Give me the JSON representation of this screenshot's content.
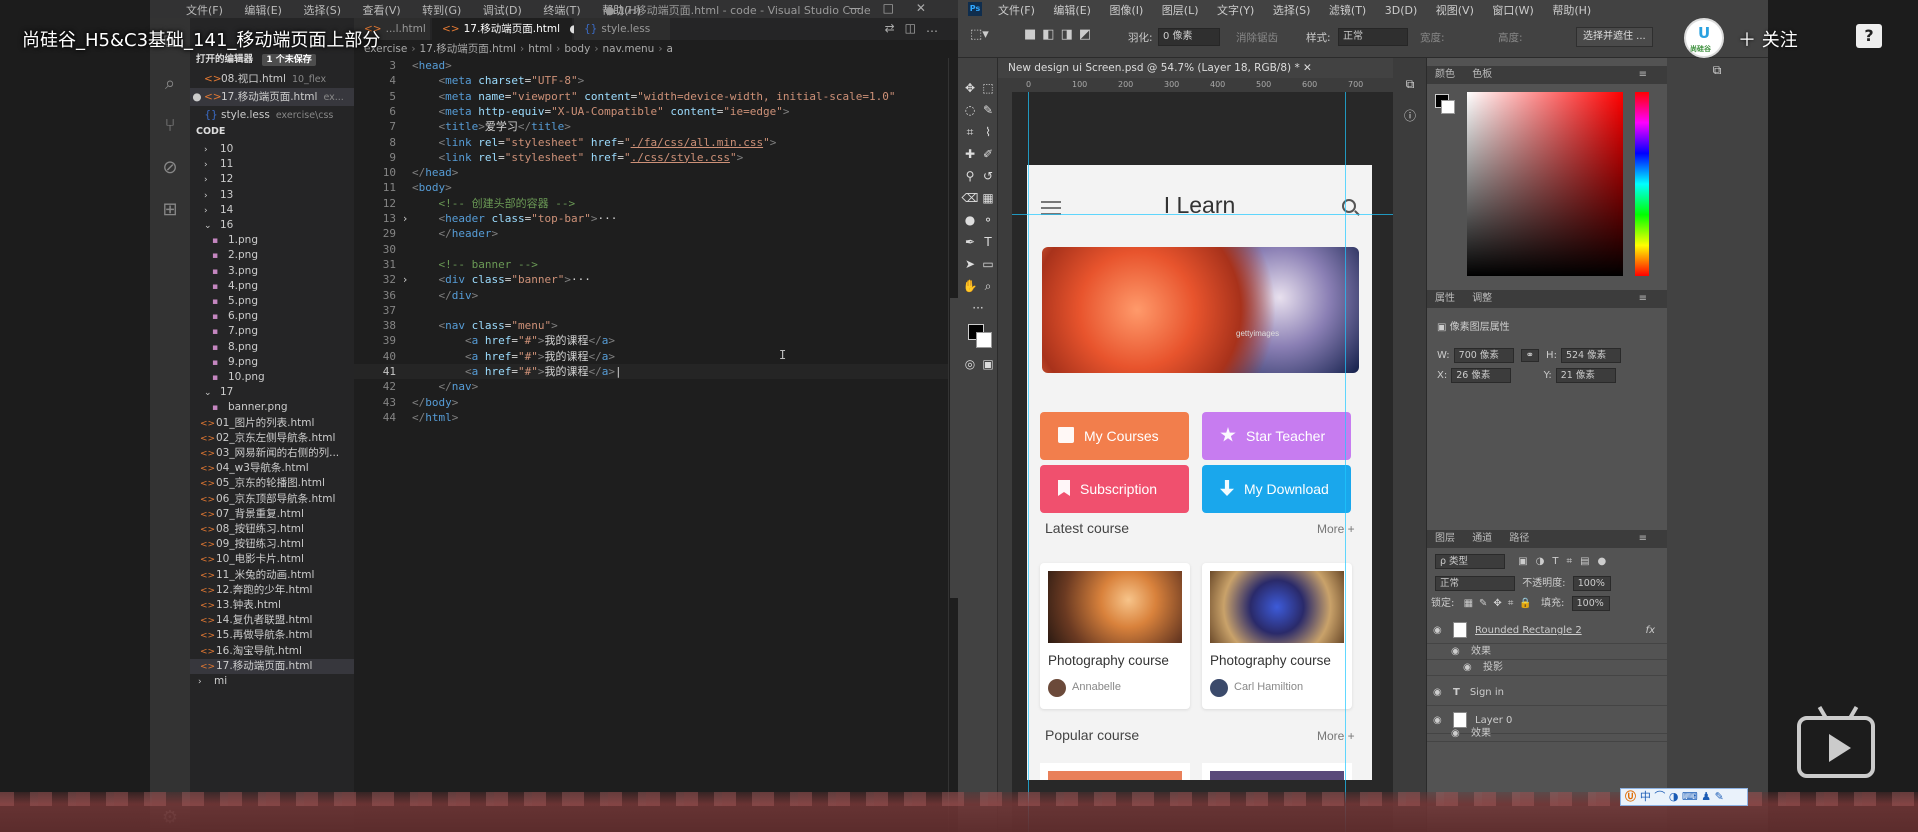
{
  "overlay": {
    "video_title": "尚硅谷_H5&C3基础_141_移动端页面上部分",
    "follow_label": "＋ 关注",
    "logo_text": "尚硅谷",
    "help_glyph": "?"
  },
  "vscode": {
    "menu": [
      "文件(F)",
      "编辑(E)",
      "选择(S)",
      "查看(V)",
      "转到(G)",
      "调试(D)",
      "终端(T)",
      "帮助(H)"
    ],
    "window_title": "● 17.移动端页面.html - code - Visual Studio Code",
    "tabs": [
      {
        "label": "...l.html",
        "icon": "<>"
      },
      {
        "label": "17.移动端页面.html",
        "icon": "<>",
        "dirty": "●"
      },
      {
        "label": "style.less",
        "icon": "{}"
      }
    ],
    "breadcrumb": [
      "exercise",
      "17.移动端页面.html",
      "html",
      "body",
      "nav.menu",
      "a"
    ],
    "sidebar": {
      "open_editors_label": "打开的编辑器",
      "unsaved_badge": "1 个未保存",
      "open_editors": [
        {
          "icon": "<>",
          "name": "08.视口.html",
          "path": "10_flex"
        },
        {
          "icon": "<>",
          "name": "17.移动端页面.html",
          "path": "ex..."
        },
        {
          "icon": "{}",
          "name": "style.less",
          "path": "exercise\\css"
        }
      ],
      "code_label": "CODE",
      "tree": [
        {
          "kind": "folder",
          "label": "10"
        },
        {
          "kind": "folder",
          "label": "11"
        },
        {
          "kind": "folder",
          "label": "12"
        },
        {
          "kind": "folder",
          "label": "13"
        },
        {
          "kind": "folder",
          "label": "14"
        },
        {
          "kind": "folder-open",
          "label": "16"
        },
        {
          "kind": "file",
          "label": "1.png"
        },
        {
          "kind": "file",
          "label": "2.png"
        },
        {
          "kind": "file",
          "label": "3.png"
        },
        {
          "kind": "file",
          "label": "4.png"
        },
        {
          "kind": "file",
          "label": "5.png"
        },
        {
          "kind": "file",
          "label": "6.png"
        },
        {
          "kind": "file",
          "label": "7.png"
        },
        {
          "kind": "file",
          "label": "8.png"
        },
        {
          "kind": "file",
          "label": "9.png"
        },
        {
          "kind": "file",
          "label": "10.png"
        },
        {
          "kind": "folder-open",
          "label": "17"
        },
        {
          "kind": "file",
          "label": "banner.png"
        },
        {
          "kind": "html",
          "label": "01_图片的列表.html"
        },
        {
          "kind": "html",
          "label": "02_京东左侧导航条.html"
        },
        {
          "kind": "html",
          "label": "03_网易新闻的右侧的列..."
        },
        {
          "kind": "html",
          "label": "04_w3导航条.html"
        },
        {
          "kind": "html",
          "label": "05_京东的轮播图.html"
        },
        {
          "kind": "html",
          "label": "06_京东顶部导航条.html"
        },
        {
          "kind": "html",
          "label": "07_背景重复.html"
        },
        {
          "kind": "html",
          "label": "08_按钮练习.html"
        },
        {
          "kind": "html",
          "label": "09_按钮练习.html"
        },
        {
          "kind": "html",
          "label": "10_电影卡片.html"
        },
        {
          "kind": "html",
          "label": "11_米兔的动画.html"
        },
        {
          "kind": "html",
          "label": "12.奔跑的少年.html"
        },
        {
          "kind": "html",
          "label": "13.钟表.html"
        },
        {
          "kind": "html",
          "label": "14.复仇者联盟.html"
        },
        {
          "kind": "html",
          "label": "15.再做导航条.html"
        },
        {
          "kind": "html",
          "label": "16.淘宝导航.html"
        },
        {
          "kind": "html",
          "label": "17.移动端页面.html"
        },
        {
          "kind": "folder",
          "label": "mi"
        }
      ]
    },
    "code": [
      {
        "n": "3",
        "html": "<span class='tg'>&lt;</span><span class='tn'>head</span><span class='tg'>&gt;</span>"
      },
      {
        "n": "4",
        "html": "    <span class='tg'>&lt;</span><span class='tn'>meta</span> <span class='at'>charset</span>=<span class='st'>\"UTF-8\"</span><span class='tg'>&gt;</span>"
      },
      {
        "n": "5",
        "html": "    <span class='tg'>&lt;</span><span class='tn'>meta</span> <span class='at'>name</span>=<span class='st'>\"viewport\"</span> <span class='at'>content</span>=<span class='st'>\"width=device-width, initial-scale=1.0\"</span>"
      },
      {
        "n": "6",
        "html": "    <span class='tg'>&lt;</span><span class='tn'>meta</span> <span class='at'>http-equiv</span>=<span class='st'>\"X-UA-Compatible\"</span> <span class='at'>content</span>=<span class='st'>\"ie=edge\"</span><span class='tg'>&gt;</span>"
      },
      {
        "n": "7",
        "html": "    <span class='tg'>&lt;</span><span class='tn'>title</span><span class='tg'>&gt;</span><span class='tx'>爱学习</span><span class='tg'>&lt;/</span><span class='tn'>title</span><span class='tg'>&gt;</span>"
      },
      {
        "n": "8",
        "html": "    <span class='tg'>&lt;</span><span class='tn'>link</span> <span class='at'>rel</span>=<span class='st'>\"stylesheet\"</span> <span class='at'>href</span>=<span class='st'>\"</span><span class='sl'>./fa/css/all.min.css</span><span class='st'>\"</span><span class='tg'>&gt;</span>"
      },
      {
        "n": "9",
        "html": "    <span class='tg'>&lt;</span><span class='tn'>link</span> <span class='at'>rel</span>=<span class='st'>\"stylesheet\"</span> <span class='at'>href</span>=<span class='st'>\"</span><span class='sl'>./css/style.css</span><span class='st'>\"</span><span class='tg'>&gt;</span>"
      },
      {
        "n": "10",
        "html": "<span class='tg'>&lt;/</span><span class='tn'>head</span><span class='tg'>&gt;</span>"
      },
      {
        "n": "11",
        "html": "<span class='tg'>&lt;</span><span class='tn'>body</span><span class='tg'>&gt;</span>"
      },
      {
        "n": "12",
        "html": "    <span class='cm'>&lt;!-- 创建头部的容器 --&gt;</span>"
      },
      {
        "n": "13",
        "fold": "›",
        "html": "    <span class='tg'>&lt;</span><span class='tn'>header</span> <span class='at'>class</span>=<span class='st'>\"top-bar\"</span><span class='tg'>&gt;</span><span class='tx'>···</span>"
      },
      {
        "n": "29",
        "html": "    <span class='tg'>&lt;/</span><span class='tn'>header</span><span class='tg'>&gt;</span>"
      },
      {
        "n": "30",
        "html": ""
      },
      {
        "n": "31",
        "html": "    <span class='cm'>&lt;!-- banner --&gt;</span>"
      },
      {
        "n": "32",
        "fold": "›",
        "html": "    <span class='tg'>&lt;</span><span class='tn'>div</span> <span class='at'>class</span>=<span class='st'>\"banner\"</span><span class='tg'>&gt;</span><span class='tx'>···</span>"
      },
      {
        "n": "36",
        "html": "    <span class='tg'>&lt;/</span><span class='tn'>div</span><span class='tg'>&gt;</span>"
      },
      {
        "n": "37",
        "html": ""
      },
      {
        "n": "38",
        "html": "    <span class='tg'>&lt;</span><span class='tn'>nav</span> <span class='at'>class</span>=<span class='st'>\"menu\"</span><span class='tg'>&gt;</span>"
      },
      {
        "n": "39",
        "html": "        <span class='tg'>&lt;</span><span class='tn'>a</span> <span class='at'>href</span>=<span class='st'>\"#\"</span><span class='tg'>&gt;</span><span class='tx'>我的课程</span><span class='tg'>&lt;/</span><span class='tn'>a</span><span class='tg'>&gt;</span>"
      },
      {
        "n": "40",
        "html": "        <span class='tg'>&lt;</span><span class='tn'>a</span> <span class='at'>href</span>=<span class='st'>\"#\"</span><span class='tg'>&gt;</span><span class='tx'>我的课程</span><span class='tg'>&lt;/</span><span class='tn'>a</span><span class='tg'>&gt;</span>"
      },
      {
        "n": "41",
        "cur": true,
        "html": "        <span class='tg'>&lt;</span><span class='tn'>a</span> <span class='at'>href</span>=<span class='st'>\"#\"</span><span class='tg'>&gt;</span><span class='tx'>我的课程</span><span class='tg'>&lt;/</span><span class='tn'>a</span><span class='tg'>&gt;</span><span class='tx'>|</span>"
      },
      {
        "n": "42",
        "html": "    <span class='tg'>&lt;/</span><span class='tn'>nav</span><span class='tg'>&gt;</span>"
      },
      {
        "n": "43",
        "html": "<span class='tg'>&lt;/</span><span class='tn'>body</span><span class='tg'>&gt;</span>"
      },
      {
        "n": "44",
        "html": "<span class='tg'>&lt;/</span><span class='tn'>html</span><span class='tg'>&gt;</span>"
      }
    ]
  },
  "photoshop": {
    "menu": [
      "文件(F)",
      "编辑(E)",
      "图像(I)",
      "图层(L)",
      "文字(Y)",
      "选择(S)",
      "滤镜(T)",
      "3D(D)",
      "视图(V)",
      "窗口(W)",
      "帮助(H)"
    ],
    "options": {
      "feather_label": "羽化:",
      "feather_value": "0 像素",
      "antialias_label": "消除锯齿",
      "style_label": "样式:",
      "style_value": "正常",
      "width_label": "宽度:",
      "height_label": "高度:",
      "select_mask_button": "选择并遮住 ..."
    },
    "doc_tab": "New design ui Screen.psd @ 54.7% (Layer 18, RGB/8) * ✕",
    "ruler_ticks": [
      "0",
      "100",
      "200",
      "300",
      "400",
      "500",
      "600",
      "700"
    ],
    "artboard": {
      "title": "I Learn",
      "banner_watermark": "gettyimages",
      "buttons": [
        {
          "label": "My Courses",
          "icon": "book",
          "color": "#f27e4c"
        },
        {
          "label": "Star Teacher",
          "icon": "star",
          "color": "#c77cf0"
        },
        {
          "label": "Subscription",
          "icon": "flag",
          "color": "#f0506e"
        },
        {
          "label": "My Download",
          "icon": "down",
          "color": "#1aa7ec"
        }
      ],
      "latest_title": "Latest course",
      "popular_title": "Popular course",
      "more_label": "More +",
      "courses": [
        {
          "name": "Photography course",
          "author": "Annabelle"
        },
        {
          "name": "Photography course",
          "author": "Carl Hamiltion"
        }
      ]
    },
    "panels": {
      "color_tabs": [
        "颜色",
        "色板"
      ],
      "props_tabs": [
        "属性",
        "调整"
      ],
      "props_title": "像素图层属性",
      "w_label": "W:",
      "w_value": "700 像素",
      "h_label": "H:",
      "h_value": "524 像素",
      "x_label": "X:",
      "x_value": "26 像素",
      "y_label": "Y:",
      "y_value": "21 像素",
      "layer_tabs": [
        "图层",
        "通道",
        "路径"
      ],
      "kind_label": "ρ 类型",
      "blend_mode": "正常",
      "opacity_label": "不透明度:",
      "opacity_value": "100%",
      "lock_label": "锁定:",
      "fill_label": "填充:",
      "fill_value": "100%",
      "layers": [
        {
          "name": "Rounded Rectangle 2",
          "fx": "fx"
        },
        {
          "name": "效果"
        },
        {
          "name": "投影"
        },
        {
          "name": "Sign in"
        },
        {
          "name": "Layer 0"
        },
        {
          "name": "效果"
        }
      ]
    }
  },
  "ime": "中 ⌒ ◑ ⌨ ♟ ✎"
}
